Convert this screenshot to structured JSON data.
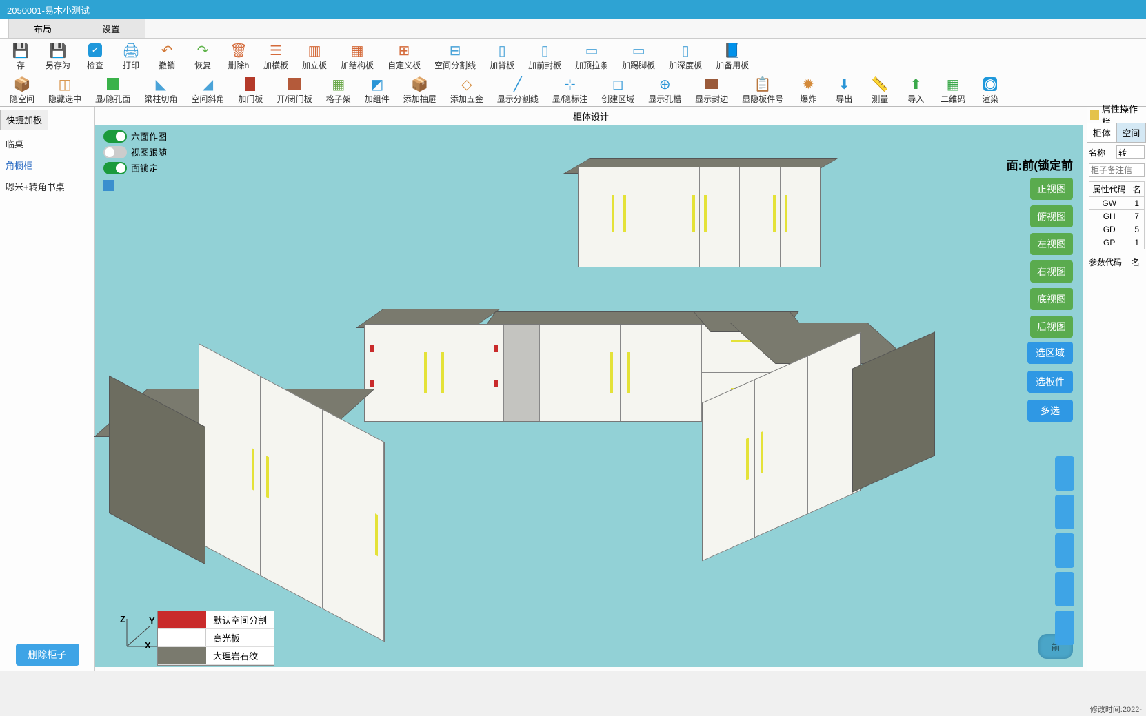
{
  "title_bar": "2050001-易木小测试",
  "menu": {
    "tab0": "",
    "tab1": "布局",
    "tab2": "设置"
  },
  "toolbar1": {
    "save": "存",
    "saveas": "另存为",
    "check": "检查",
    "print": "打印",
    "undo": "撤销",
    "redo": "恢复",
    "delete": "删除h",
    "addh": "加横板",
    "addv": "加立板",
    "addstruct": "加结构板",
    "custom": "自定义板",
    "split": "空间分割线",
    "addback": "加背板",
    "addfront": "加前封板",
    "addtop": "加顶拉条",
    "addkick": "加踢脚板",
    "adddepth": "加深度板",
    "addspare": "加备用板"
  },
  "toolbar2": {
    "hidespace": "隐空间",
    "hidesel": "隐藏选中",
    "showhole": "显/隐孔面",
    "beamcut": "梁柱切角",
    "spaceangle": "空间斜角",
    "adddoor": "加门板",
    "opendoor": "开/闭门板",
    "lattice": "格子架",
    "addpart": "加组件",
    "adddrawer": "添加抽屉",
    "addhw": "添加五金",
    "showsplit": "显示分割线",
    "showmark": "显/隐标注",
    "createzone": "创建区域",
    "showslot": "显示孔槽",
    "showedge": "显示封边",
    "showpartno": "显隐板件号",
    "explode": "爆炸",
    "export": "导出",
    "measure": "测量",
    "import": "导入",
    "qr": "二维码",
    "render": "渲染"
  },
  "viewport_title": "柜体设计",
  "toggles": {
    "six": "六面作图",
    "follow": "视图跟随",
    "lock": "面锁定"
  },
  "face_label": "面:前(锁定前",
  "view_btns": {
    "front": "正视图",
    "top": "俯视图",
    "left": "左视图",
    "right": "右视图",
    "bottom": "底视图",
    "back": "后视图"
  },
  "sel_btns": {
    "zone": "选区域",
    "part": "选板件",
    "multi": "多选"
  },
  "legend": {
    "l1": "默认空间分割",
    "l2": "高光板",
    "l3": "大理岩石纹"
  },
  "left": {
    "tab": "快捷加板",
    "item1": "临桌",
    "item2": "角橱柜",
    "item3": "嗯米+转角书桌",
    "delete_btn": "删除柜子"
  },
  "right": {
    "header": "属性操作栏",
    "tab1": "柜体",
    "tab2": "空间",
    "name_label": "名称",
    "name_value": "转",
    "note_placeholder": "柜子备注信",
    "attr_label": "属性代码",
    "attr_val": "名",
    "gw": "GW",
    "gh": "GH",
    "gd": "GD",
    "gp": "GP",
    "gw_v": "1",
    "gh_v": "7",
    "gd_v": "5",
    "gp_v": "1",
    "param_label": "参数代码",
    "param_val": "名"
  },
  "status": "修改时间:2022-",
  "pillow_label": "前",
  "axis": {
    "x": "X",
    "y": "Y",
    "z": "Z"
  }
}
